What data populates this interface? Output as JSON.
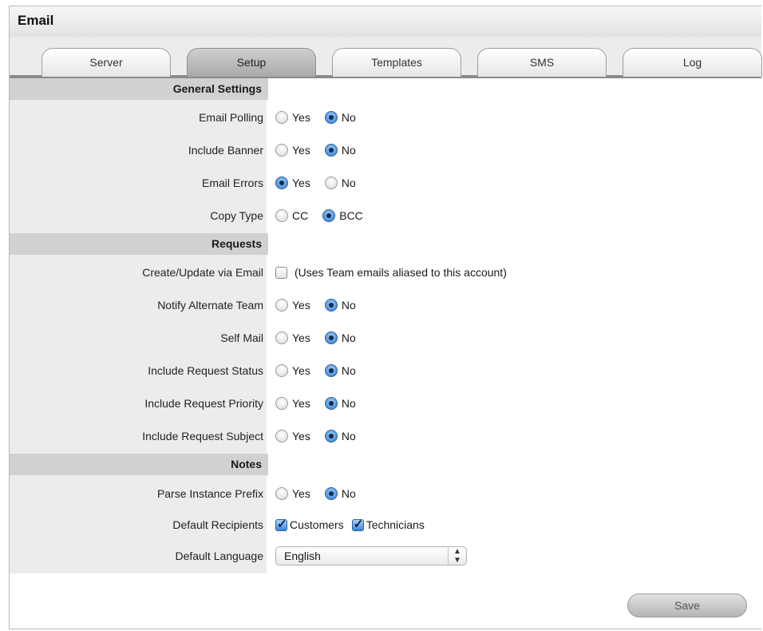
{
  "window": {
    "title": "Email"
  },
  "tabs": [
    {
      "label": "Server"
    },
    {
      "label": "Setup",
      "active": true
    },
    {
      "label": "Templates"
    },
    {
      "label": "SMS"
    },
    {
      "label": "Log"
    }
  ],
  "sections": {
    "general": "General Settings",
    "requests": "Requests",
    "notes": "Notes"
  },
  "fields": {
    "email_polling": {
      "label": "Email Polling",
      "options": [
        "Yes",
        "No"
      ],
      "selected": "No"
    },
    "include_banner": {
      "label": "Include Banner",
      "options": [
        "Yes",
        "No"
      ],
      "selected": "No"
    },
    "email_errors": {
      "label": "Email Errors",
      "options": [
        "Yes",
        "No"
      ],
      "selected": "Yes"
    },
    "copy_type": {
      "label": "Copy Type",
      "options": [
        "CC",
        "BCC"
      ],
      "selected": "BCC"
    },
    "create_update": {
      "label": "Create/Update via Email",
      "checked": false,
      "note": "(Uses Team emails aliased to this account)"
    },
    "notify_alternate": {
      "label": "Notify Alternate Team",
      "options": [
        "Yes",
        "No"
      ],
      "selected": "No"
    },
    "self_mail": {
      "label": "Self Mail",
      "options": [
        "Yes",
        "No"
      ],
      "selected": "No"
    },
    "req_status": {
      "label": "Include Request Status",
      "options": [
        "Yes",
        "No"
      ],
      "selected": "No"
    },
    "req_priority": {
      "label": "Include Request Priority",
      "options": [
        "Yes",
        "No"
      ],
      "selected": "No"
    },
    "req_subject": {
      "label": "Include Request Subject",
      "options": [
        "Yes",
        "No"
      ],
      "selected": "No"
    },
    "parse_prefix": {
      "label": "Parse Instance Prefix",
      "options": [
        "Yes",
        "No"
      ],
      "selected": "No"
    },
    "default_recipients": {
      "label": "Default Recipients",
      "options": [
        "Customers",
        "Technicians"
      ],
      "checked": [
        true,
        true
      ]
    },
    "default_language": {
      "label": "Default Language",
      "value": "English"
    }
  },
  "buttons": {
    "save": "Save"
  },
  "colors": {
    "accent": "#2f7dd6",
    "section_header": "#d1d1d1",
    "label_column": "#ececec"
  }
}
